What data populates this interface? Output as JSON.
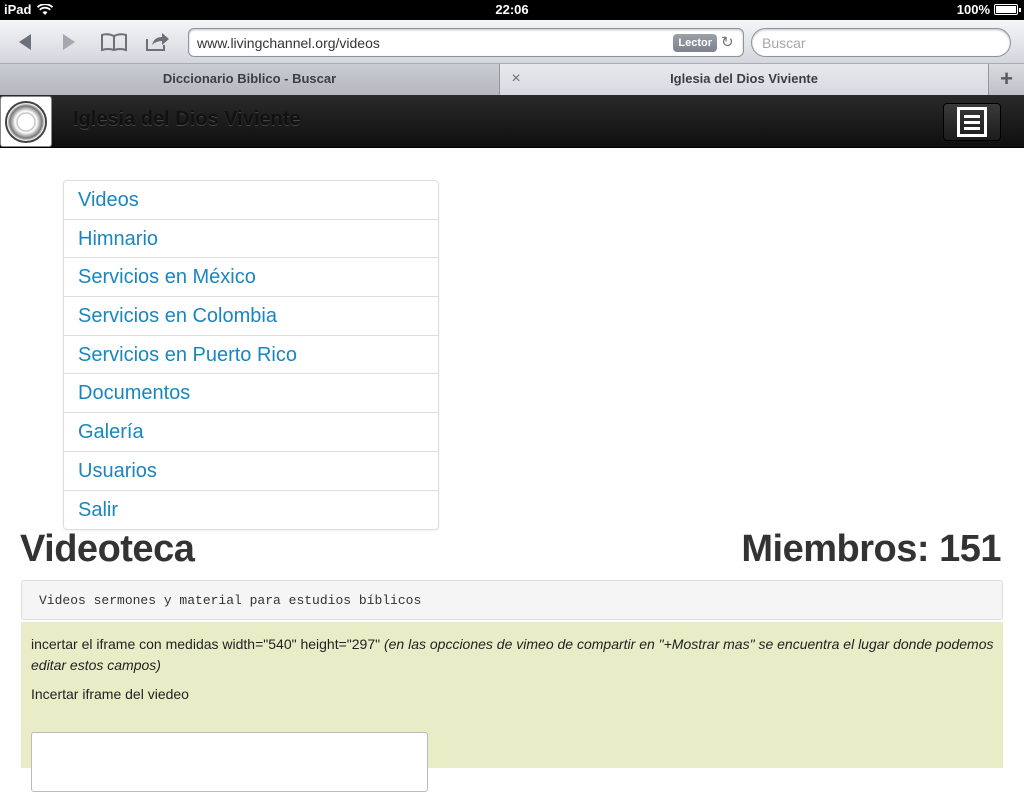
{
  "status": {
    "device": "iPad",
    "time": "22:06",
    "battery_text": "100%",
    "battery_level": 1.0
  },
  "browser": {
    "url": "www.livingchannel.org/videos",
    "reader_label": "Lector",
    "search_placeholder": "Buscar",
    "tabs": [
      {
        "label": "Diccionario Biblico - Buscar"
      },
      {
        "label": "Iglesia del Dios Viviente"
      }
    ],
    "close_glyph": "×",
    "add_glyph": "+"
  },
  "site": {
    "brand": "Iglesia del Dios Viviente"
  },
  "nav": {
    "items": [
      {
        "label": "Videos"
      },
      {
        "label": "Himnario"
      },
      {
        "label": "Servicios en México"
      },
      {
        "label": "Servicios en Colombia"
      },
      {
        "label": "Servicios en Puerto Rico"
      },
      {
        "label": "Documentos"
      },
      {
        "label": "Galería"
      },
      {
        "label": "Usuarios"
      },
      {
        "label": "Salir"
      }
    ]
  },
  "main": {
    "title": "Videoteca",
    "members": "Miembros: 151",
    "subtitle": "Videos sermones y material para estudios bíblicos",
    "instruction_plain": "incertar el iframe con medidas width=\"540\" height=\"297\" ",
    "instruction_italic": "(en las opcciones de vimeo de compartir en \"+Mostrar mas\" se encuentra el lugar donde podemos editar estos campos)",
    "iframe_label": "Incertar iframe del viedeo"
  }
}
